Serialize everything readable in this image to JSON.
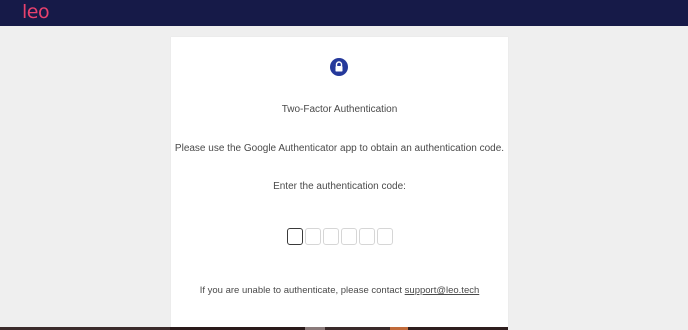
{
  "header": {
    "logo_text": "leo",
    "background_color": "#161a48",
    "logo_color": "#e8416d"
  },
  "auth": {
    "icon": "lock-icon",
    "title": "Two-Factor Authentication",
    "instruction": "Please use the Google Authenticator app to obtain an authentication code.",
    "prompt": "Enter the authentication code:",
    "code_digits": [
      "",
      "",
      "",
      "",
      "",
      ""
    ],
    "support_prefix": "If you are unable to authenticate, please contact ",
    "support_email": "support@leo.tech",
    "accent_color": "#25399b"
  }
}
